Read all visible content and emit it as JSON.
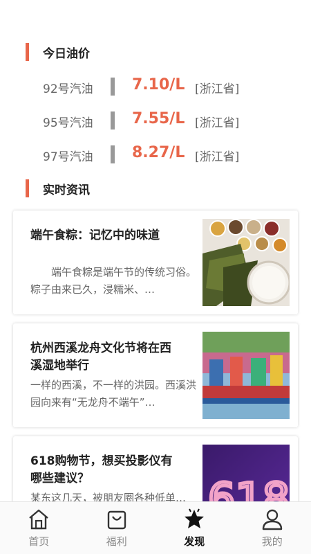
{
  "oil": {
    "title": "今日油价",
    "rows": [
      {
        "name": "92号汽油",
        "price": "7.10/L",
        "region": "[浙江省]"
      },
      {
        "name": "95号汽油",
        "price": "7.55/L",
        "region": "[浙江省]"
      },
      {
        "name": "97号汽油",
        "price": "8.27/L",
        "region": "[浙江省]"
      }
    ]
  },
  "news": {
    "title": "实时资讯",
    "items": [
      {
        "title": "端午食粽：记忆中的味道",
        "desc": "　　端午食粽是端午节的传统习俗。粽子由来已久，浸糯米、…"
      },
      {
        "title": "杭州西溪龙舟文化节将在西溪湿地举行",
        "desc": "一样的西溪，不一样的洪园。西溪洪园向来有“无龙舟不端午”…"
      },
      {
        "title": "618购物节，想买投影仪有哪些建议？",
        "desc": "某东这几天，被朋友圈各种低单…"
      }
    ]
  },
  "tabs": [
    {
      "label": "首页",
      "icon": "home-icon"
    },
    {
      "label": "福利",
      "icon": "shopping-bag-icon"
    },
    {
      "label": "发现",
      "icon": "star-icon",
      "active": true
    },
    {
      "label": "我的",
      "icon": "user-icon"
    }
  ],
  "colors": {
    "accent": "#e8664a"
  }
}
